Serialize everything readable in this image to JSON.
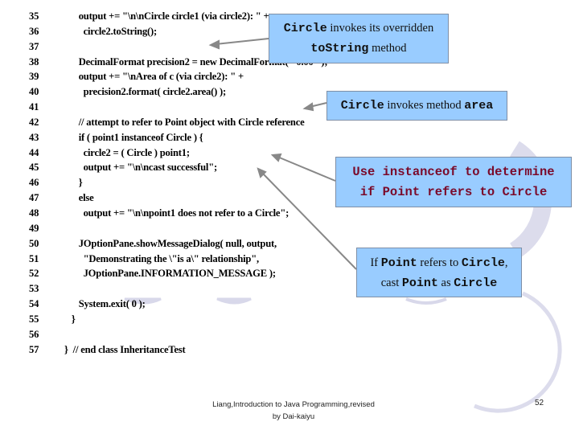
{
  "slide": {
    "code_lines": [
      {
        "num": "35",
        "text": "      output += \"\\n\\nCircle circle1 (via circle2): \" +"
      },
      {
        "num": "36",
        "text": "        circle2.toString();"
      },
      {
        "num": "37",
        "text": ""
      },
      {
        "num": "38",
        "text": "      DecimalFormat precision2 = new DecimalFormat( \"0.00\" );"
      },
      {
        "num": "39",
        "text": "      output += \"\\nArea of c (via circle2): \" +"
      },
      {
        "num": "40",
        "text": "        precision2.format( circle2.area() );"
      },
      {
        "num": "41",
        "text": ""
      },
      {
        "num": "42",
        "text": "      // attempt to refer to Point object with Circle reference"
      },
      {
        "num": "43",
        "text": "      if ( point1 instanceof Circle ) {"
      },
      {
        "num": "44",
        "text": "        circle2 = ( Circle ) point1;"
      },
      {
        "num": "45",
        "text": "        output += \"\\n\\ncast successful\";"
      },
      {
        "num": "46",
        "text": "      }"
      },
      {
        "num": "47",
        "text": "      else"
      },
      {
        "num": "48",
        "text": "        output += \"\\n\\npoint1 does not refer to a Circle\";"
      },
      {
        "num": "49",
        "text": ""
      },
      {
        "num": "50",
        "text": "      JOptionPane.showMessageDialog( null, output,"
      },
      {
        "num": "51",
        "text": "        \"Demonstrating the \\\"is a\\\" relationship\","
      },
      {
        "num": "52",
        "text": "        JOptionPane.INFORMATION_MESSAGE );"
      },
      {
        "num": "53",
        "text": ""
      },
      {
        "num": "54",
        "text": "      System.exit( 0 );"
      },
      {
        "num": "55",
        "text": "   }"
      },
      {
        "num": "56",
        "text": ""
      },
      {
        "num": "57",
        "text": "}  // end class InheritanceTest"
      }
    ],
    "callouts": {
      "tostring": {
        "code1": "Circle",
        "text1": " invokes its overridden",
        "code2": "toString",
        "text2": " method"
      },
      "area": {
        "code1": "Circle",
        "text1": " invokes method ",
        "code2": "area"
      },
      "instanceof": {
        "line1": "Use instanceof to determine",
        "line2": "if Point refers to Circle"
      },
      "cast": {
        "t1": "If ",
        "c1": "Point",
        "t2": " refers to ",
        "c2": "Circle",
        "t3": ",",
        "t4": "cast ",
        "c3": "Point",
        "t5": " as ",
        "c4": "Circle"
      }
    },
    "footer": {
      "line1": "Liang,Introduction to Java Programming,revised",
      "line2": "by Dai-kaiyu"
    },
    "page_number": "52",
    "colors": {
      "callout_bg": "#99ccff",
      "callout_accent_text": "#7a0a2a",
      "decor": "#d8d8ea"
    }
  }
}
